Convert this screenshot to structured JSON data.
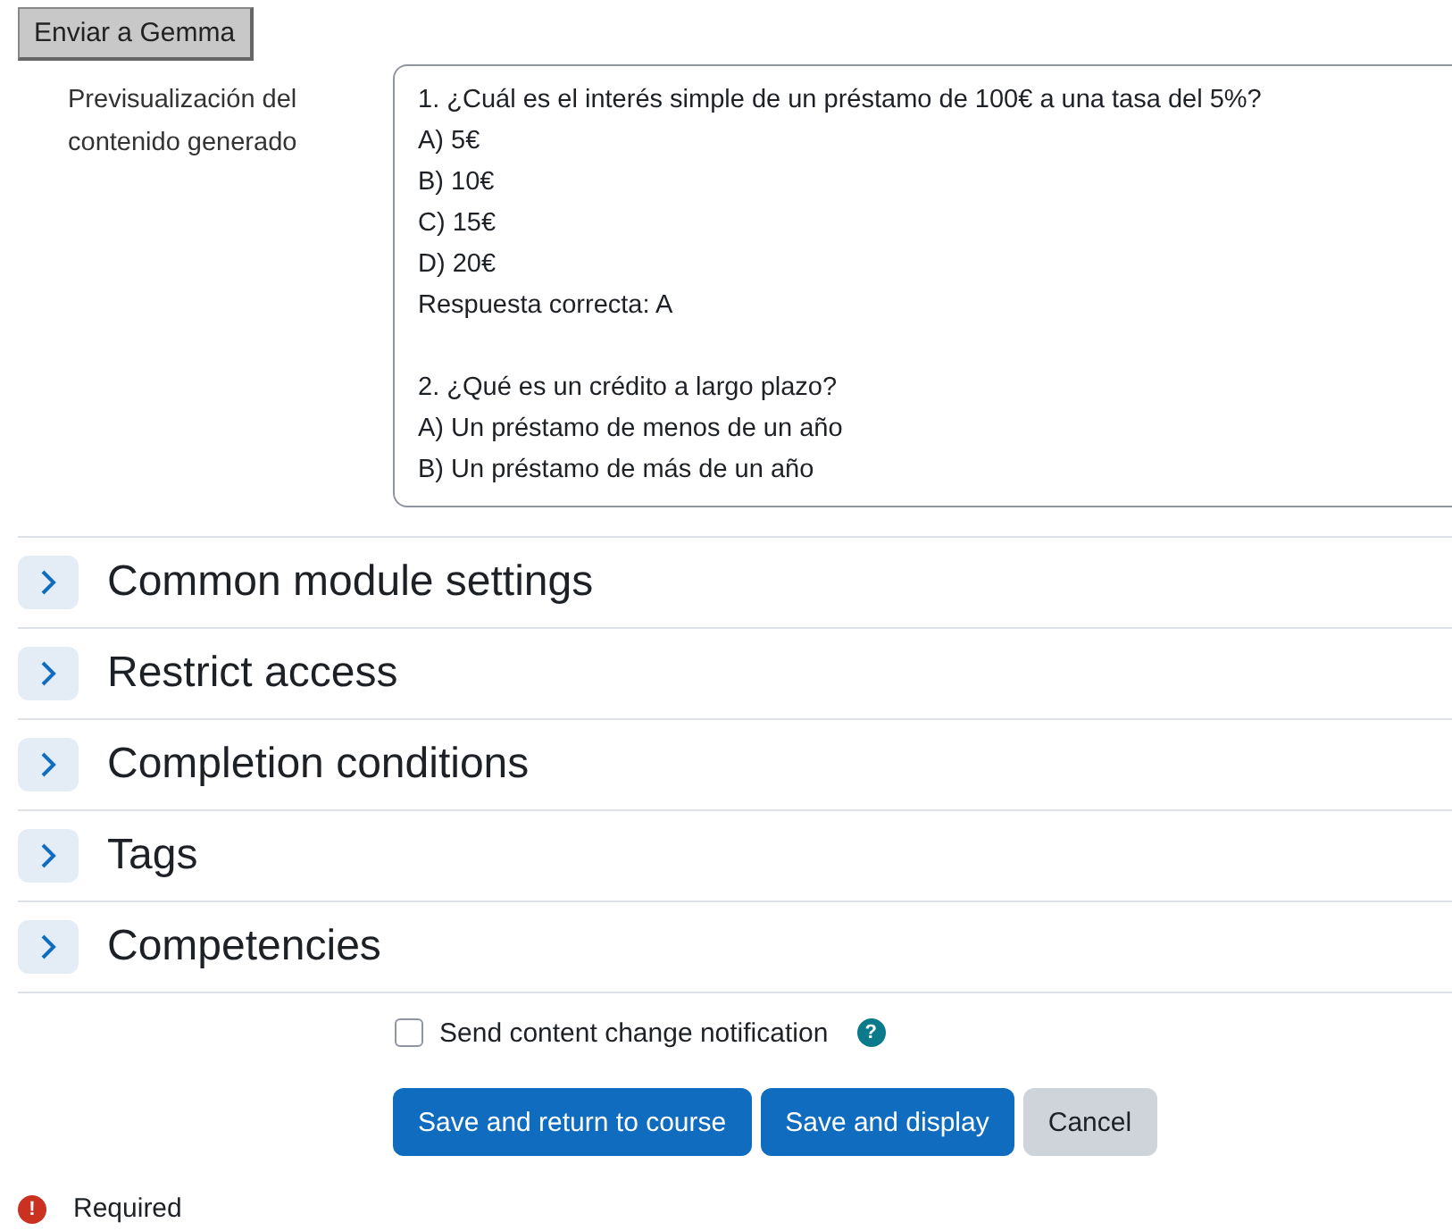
{
  "send_button": "Enviar a Gemma",
  "preview": {
    "label": "Previsualización del contenido generado",
    "paragraphs": [
      [
        "1. ¿Cuál es el interés simple de un préstamo de 100€ a una tasa del 5%?",
        "A) 5€",
        "B) 10€",
        "C) 15€",
        "D) 20€",
        "Respuesta correcta: A"
      ],
      [
        "2. ¿Qué es un crédito a largo plazo?",
        "A) Un préstamo de menos de un año",
        "B) Un préstamo de más de un año"
      ]
    ]
  },
  "sections": [
    {
      "title": "Common module settings",
      "expanded": false
    },
    {
      "title": "Restrict access",
      "expanded": false
    },
    {
      "title": "Completion conditions",
      "expanded": false
    },
    {
      "title": "Tags",
      "expanded": false
    },
    {
      "title": "Competencies",
      "expanded": false
    }
  ],
  "notification": {
    "label": "Send content change notification",
    "checked": false,
    "help": "?"
  },
  "buttons": [
    {
      "label": "Save and return to course",
      "kind": "primary"
    },
    {
      "label": "Save and display",
      "kind": "primary"
    },
    {
      "label": "Cancel",
      "kind": "secondary"
    }
  ],
  "required": {
    "icon": "!",
    "label": "Required"
  }
}
